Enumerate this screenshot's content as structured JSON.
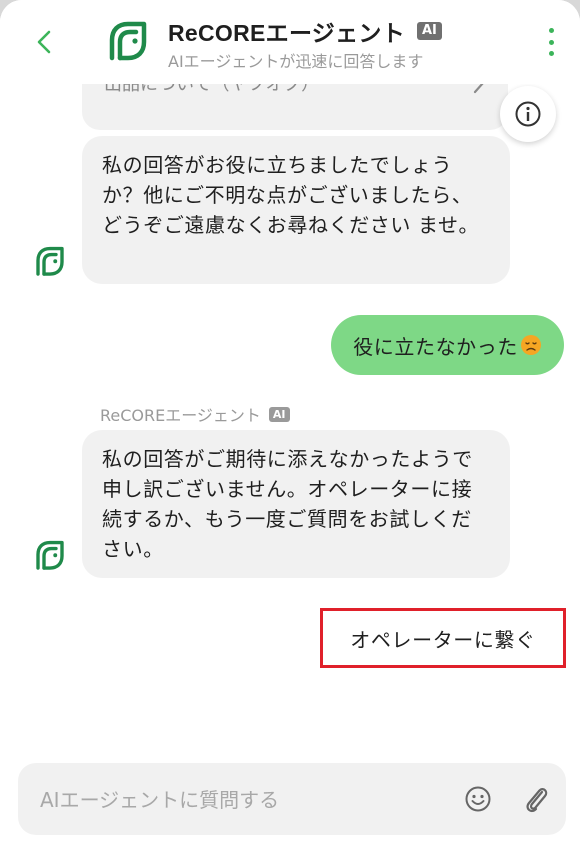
{
  "header": {
    "title": "ReCOREエージェント",
    "badge": "AI",
    "subtitle": "AIエージェントが迅速に回答します",
    "accent": "#3cb45a",
    "brand_icon": "leaf-icon"
  },
  "messages": {
    "partial_card_text": "出品について（ヤフオク）",
    "bot_reply_1": "私の回答がお役に立ちましたでしょうか？他にご不明な点がございましたら、どうぞご遠慮なくお尋ねください ませ。",
    "user_message": "役に立たなかった",
    "user_emoji": "disappointed-face-icon",
    "sender_name": "ReCOREエージェント",
    "sender_badge": "AI",
    "bot_reply_2": "私の回答がご期待に添えなかったようで申し訳ございません。オペレーターに接続するか、もう一度ご質問をお試しください。",
    "operator_button": "オペレーターに繋ぐ",
    "highlight_color": "#e0202a",
    "user_bubble_color": "#7ed886"
  },
  "input": {
    "placeholder": "AIエージェントに質問する",
    "value": ""
  }
}
